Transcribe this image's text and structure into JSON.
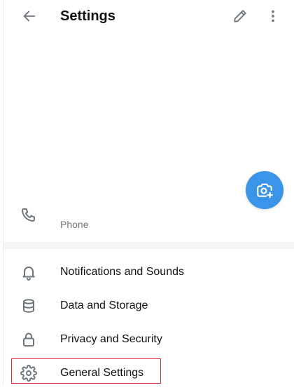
{
  "header": {
    "title": "Settings",
    "back_icon": "arrow-left-icon",
    "edit_icon": "pencil-icon",
    "more_icon": "more-vertical-icon"
  },
  "profile": {
    "phone_label": "Phone",
    "phone_icon": "phone-icon",
    "camera_icon": "camera-add-icon"
  },
  "menu": {
    "items": [
      {
        "label": "Notifications and Sounds",
        "icon": "bell-icon"
      },
      {
        "label": "Data and Storage",
        "icon": "database-icon"
      },
      {
        "label": "Privacy and Security",
        "icon": "lock-icon"
      },
      {
        "label": "General Settings",
        "icon": "gear-icon"
      }
    ]
  },
  "colors": {
    "accent": "#3a94e8",
    "icon": "#707579",
    "text": "#111111",
    "secondary_text": "#707579",
    "highlight": "#e0263a"
  }
}
